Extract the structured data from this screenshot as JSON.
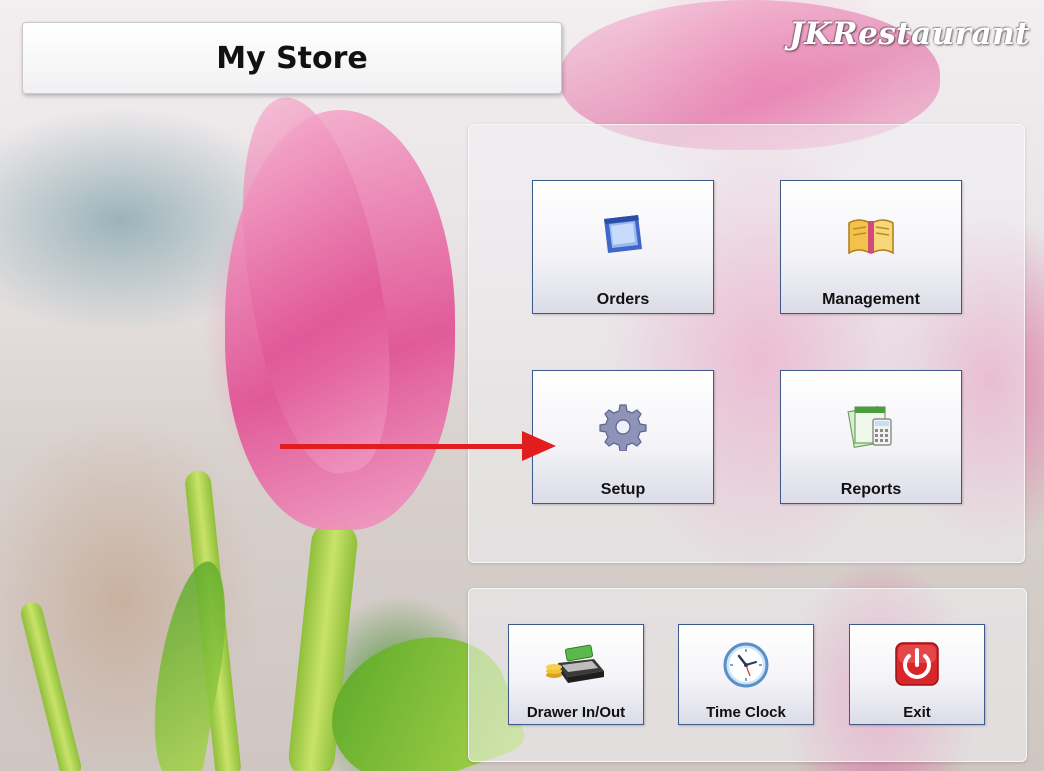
{
  "store": {
    "title": "My Store"
  },
  "brand": {
    "name": "JKRestaurant"
  },
  "main_tiles": [
    {
      "label": "Orders",
      "icon": "window-icon"
    },
    {
      "label": "Management",
      "icon": "open-book-icon"
    },
    {
      "label": "Setup",
      "icon": "gear-icon"
    },
    {
      "label": "Reports",
      "icon": "calculator-report-icon"
    }
  ],
  "bottom_tiles": [
    {
      "label": "Drawer In/Out",
      "icon": "cash-drawer-icon"
    },
    {
      "label": "Time Clock",
      "icon": "clock-icon"
    },
    {
      "label": "Exit",
      "icon": "power-icon"
    }
  ],
  "colors": {
    "tile_border": "#3d5a8a",
    "annotation_arrow": "#e21d1d",
    "exit_red": "#d8262a"
  }
}
